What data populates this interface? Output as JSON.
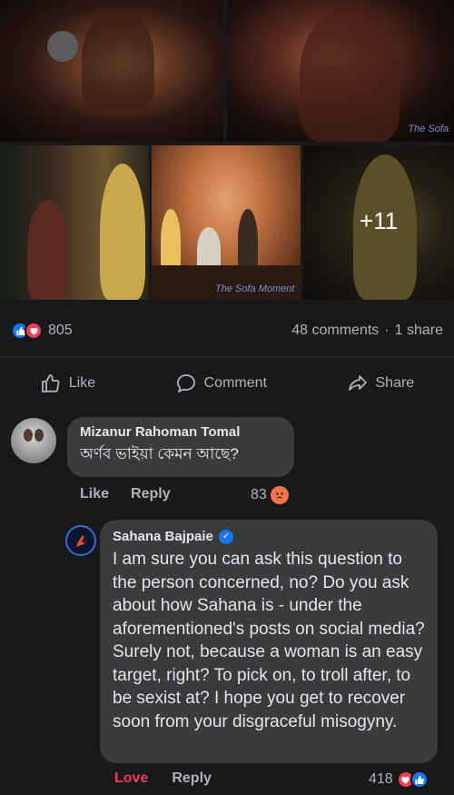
{
  "photos": {
    "more_count": "+11",
    "watermark_a": "The Sofa",
    "watermark_b": "The Sofa Moment"
  },
  "reactions": {
    "icons": [
      "like-icon",
      "love-icon"
    ],
    "count": "805",
    "comments": "48 comments",
    "separator": "·",
    "shares": "1 share"
  },
  "actions": {
    "like_label": "Like",
    "comment_label": "Comment",
    "share_label": "Share"
  },
  "comment1": {
    "author": "Mizanur Rahoman Tomal",
    "text": "অর্ণব ভাইয়া কেমন আছে?",
    "like_label": "Like",
    "reply_label": "Reply",
    "reaction_count": "83",
    "reaction_icon": "angry-icon"
  },
  "comment2": {
    "author": "Sahana Bajpaie",
    "verified": true,
    "text": "I am sure you can ask this question to the person concerned, no? Do you ask about how Sahana is - under the aforementioned's posts on social media? Surely not, because a woman is an easy target, right? To pick on, to troll after, to be sexist at? I hope you get to recover soon from your disgraceful misogyny.",
    "love_label": "Love",
    "reply_label": "Reply",
    "reaction_count": "418",
    "reaction_icons": [
      "love-icon",
      "like-icon"
    ]
  },
  "colors": {
    "background": "#18191a",
    "bubble": "#3a3b3c",
    "like_blue": "#1877f2",
    "love_red": "#f33e58",
    "angry_orange": "#f7714b"
  }
}
